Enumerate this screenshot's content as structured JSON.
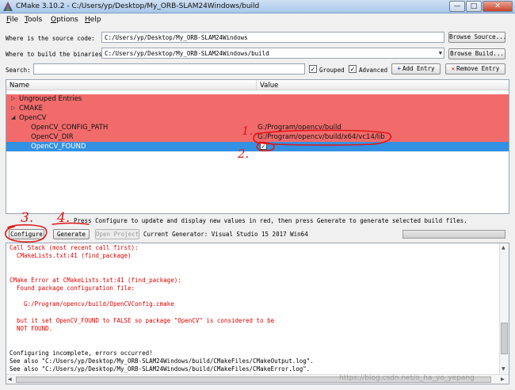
{
  "window": {
    "title": "CMake 3.10.2 - C:/Users/yp/Desktop/My_ORB-SLAM24Windows/build",
    "min_glyph": "—",
    "max_glyph": "□",
    "close_glyph": "✕"
  },
  "menu": [
    {
      "label": "File",
      "mnemonic": "F",
      "rest": "ile"
    },
    {
      "label": "Tools",
      "mnemonic": "T",
      "rest": "ools"
    },
    {
      "label": "Options",
      "mnemonic": "O",
      "rest": "ptions"
    },
    {
      "label": "Help",
      "mnemonic": "H",
      "rest": "elp"
    }
  ],
  "source": {
    "label": "Where is the source code:",
    "value": "C:/Users/yp/Desktop/My_ORB-SLAM24Windows",
    "browse_label": "Browse Source..."
  },
  "build": {
    "label": "Where to build the binaries:",
    "value": "C:/Users/yp/Desktop/My_ORB-SLAM24Windows/build",
    "dropdown_glyph": "▼",
    "browse_label": "Browse Build..."
  },
  "search": {
    "label": "Search:",
    "value": "",
    "grouped_label": "Grouped",
    "grouped_checked": true,
    "advanced_label": "Advanced",
    "advanced_checked": true,
    "add_entry_label": "Add Entry",
    "add_entry_glyph": "+",
    "remove_entry_label": "Remove Entry",
    "remove_entry_glyph": "✕"
  },
  "cache": {
    "headers": {
      "name": "Name",
      "value": "Value"
    },
    "rows": [
      {
        "name": "Ungrouped Entries",
        "value": "",
        "level": 0,
        "expander": "▷"
      },
      {
        "name": "CMAKE",
        "value": "",
        "level": 0,
        "expander": "▷"
      },
      {
        "name": "OpenCV",
        "value": "",
        "level": 0,
        "expander": "◢"
      },
      {
        "name": "OpenCV_CONFIG_PATH",
        "value": "G:/Program/opencv/build",
        "level": 1
      },
      {
        "name": "OpenCV_DIR",
        "value": "G:/Program/opencv/build/x64/vc14/lib",
        "level": 1
      },
      {
        "name": "OpenCV_FOUND",
        "value": "",
        "level": 1,
        "checkbox": true,
        "checked": true,
        "selected": true
      }
    ]
  },
  "hint": "Press Configure to update and display new values in red, then press Generate to generate selected build files.",
  "actions": {
    "configure_label": "Configure",
    "generate_label": "Generate",
    "open_project_label": "Open Project",
    "current_generator": "Current Generator: Visual Studio 15 2017 Win64"
  },
  "progress": {
    "value_percent": 0
  },
  "output": {
    "lines": [
      {
        "text": "Call Stack (most recent call first):",
        "kind": "err"
      },
      {
        "text": "  CMakeLists.txt:41 (find_package)",
        "kind": "err"
      },
      {
        "text": "",
        "kind": "err"
      },
      {
        "text": "",
        "kind": "err"
      },
      {
        "text": "CMake Error at CMakeLists.txt:41 (find_package):",
        "kind": "err"
      },
      {
        "text": "  Found package configuration file:",
        "kind": "err"
      },
      {
        "text": "",
        "kind": "err"
      },
      {
        "text": "    G:/Program/opencv/build/OpenCVConfig.cmake",
        "kind": "err"
      },
      {
        "text": "",
        "kind": "err"
      },
      {
        "text": "  but it set OpenCV_FOUND to FALSE so package \"OpenCV\" is considered to be",
        "kind": "err"
      },
      {
        "text": "  NOT FOUND.",
        "kind": "err"
      },
      {
        "text": "",
        "kind": "err"
      },
      {
        "text": "",
        "kind": "err"
      },
      {
        "text": "Configuring incomplete, errors occurred!",
        "kind": "ok"
      },
      {
        "text": "See also \"C:/Users/yp/Desktop/My_ORB-SLAM24Windows/build/CMakeFiles/CMakeOutput.log\".",
        "kind": "ok"
      },
      {
        "text": "See also \"C:/Users/yp/Desktop/My_ORB-SLAM24Windows/build/CMakeFiles/CMakeError.log\".",
        "kind": "ok"
      }
    ],
    "watermark": "https://blog.csdn.net/o_ha_yo_yepang"
  },
  "annotations": {
    "step1": "1.",
    "step2": "2.",
    "step3": "3.",
    "step4": "4.",
    "color": "#e01818"
  },
  "colors": {
    "changed_row": "#f26b6b",
    "selected_row": "#3391e3",
    "error_text": "#e00000"
  }
}
